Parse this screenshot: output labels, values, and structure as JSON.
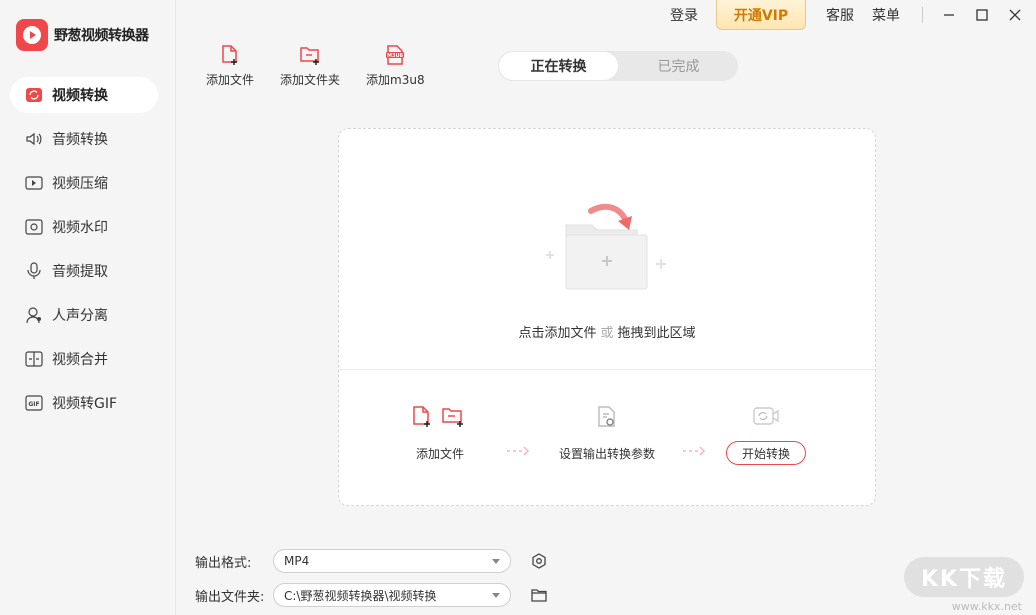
{
  "app": {
    "title": "野葱视频转换器"
  },
  "titlebar": {
    "login": "登录",
    "vip": "开通VIP",
    "service": "客服",
    "menu": "菜单"
  },
  "sidebar": {
    "items": [
      {
        "label": "视频转换",
        "icon": "video-convert-icon"
      },
      {
        "label": "音频转换",
        "icon": "audio-convert-icon"
      },
      {
        "label": "视频压缩",
        "icon": "video-compress-icon"
      },
      {
        "label": "视频水印",
        "icon": "video-watermark-icon"
      },
      {
        "label": "音频提取",
        "icon": "audio-extract-icon"
      },
      {
        "label": "人声分离",
        "icon": "vocal-separate-icon"
      },
      {
        "label": "视频合并",
        "icon": "video-merge-icon"
      },
      {
        "label": "视频转GIF",
        "icon": "video-gif-icon"
      }
    ]
  },
  "toolbar": {
    "add_file": "添加文件",
    "add_folder": "添加文件夹",
    "add_m3u8": "添加m3u8"
  },
  "tabs": {
    "converting": "正在转换",
    "completed": "已完成"
  },
  "dropzone": {
    "hint_click": "点击添加文件",
    "hint_or": "或",
    "hint_drag": "拖拽到此区域",
    "steps": {
      "add_file": "添加文件",
      "set_params": "设置输出转换参数",
      "start": "开始转换"
    }
  },
  "settings": {
    "format_label": "输出格式:",
    "format_value": "MP4",
    "folder_label": "输出文件夹:",
    "folder_value": "C:\\野葱视频转换器\\视频转换"
  },
  "watermark": {
    "main": "KK下载",
    "sub": "www.kkx.net"
  },
  "colors": {
    "accent": "#f0474a",
    "vip_text": "#d07a00"
  }
}
